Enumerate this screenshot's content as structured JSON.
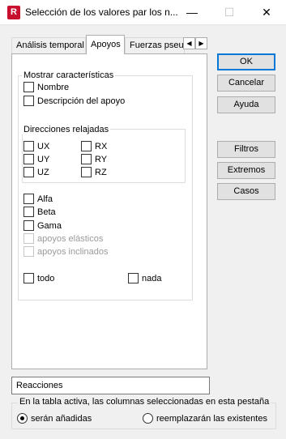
{
  "window": {
    "icon_letter": "R",
    "title": "Selección de los valores par los n...",
    "minimize": "—",
    "maximize": "☐",
    "close": "✕"
  },
  "tabs": [
    {
      "label": "Análisis temporal",
      "selected": false
    },
    {
      "label": "Apoyos",
      "selected": true
    },
    {
      "label": "Fuerzas pseu",
      "selected": false
    }
  ],
  "tab_scroll": {
    "left": "◀",
    "right": "▶"
  },
  "show_group": {
    "label": "Mostrar características",
    "items": [
      {
        "label": "Nombre",
        "checked": false,
        "enabled": true
      },
      {
        "label": "Descripción del apoyo",
        "checked": false,
        "enabled": true
      }
    ]
  },
  "relaxed_group": {
    "label": "Direcciones relajadas",
    "items": [
      {
        "label": "UX",
        "checked": false
      },
      {
        "label": "RX",
        "checked": false
      },
      {
        "label": "UY",
        "checked": false
      },
      {
        "label": "RY",
        "checked": false
      },
      {
        "label": "UZ",
        "checked": false
      },
      {
        "label": "RZ",
        "checked": false
      }
    ]
  },
  "angle_items": [
    {
      "label": "Alfa",
      "checked": false,
      "enabled": true
    },
    {
      "label": "Beta",
      "checked": false,
      "enabled": true
    },
    {
      "label": "Gama",
      "checked": false,
      "enabled": true
    },
    {
      "label": "apoyos elásticos",
      "checked": false,
      "enabled": false
    },
    {
      "label": "apoyos inclinados",
      "checked": false,
      "enabled": false
    }
  ],
  "all_none": {
    "all": "todo",
    "none": "nada"
  },
  "buttons": {
    "ok": "OK",
    "cancel": "Cancelar",
    "help": "Ayuda",
    "filters": "Filtros",
    "extremes": "Extremos",
    "cases": "Casos"
  },
  "name_field": {
    "value": "Reacciones"
  },
  "mode_group": {
    "label": "En la tabla activa, las columnas seleccionadas en esta pestaña",
    "add": {
      "label": "serán añadidas",
      "selected": true
    },
    "replace": {
      "label": "reemplazarán las existentes",
      "selected": false
    }
  }
}
